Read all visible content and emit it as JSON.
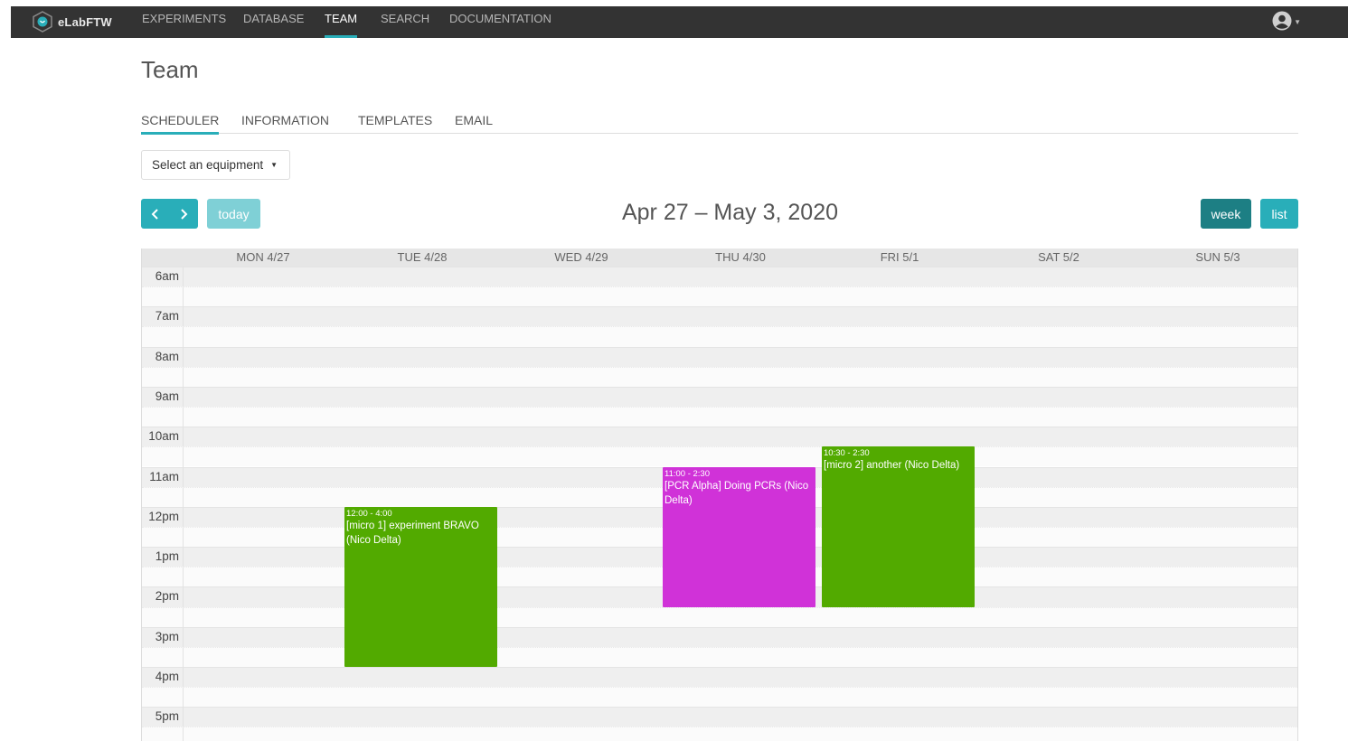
{
  "nav": {
    "brand": "eLabFTW",
    "items": [
      {
        "label": "EXPERIMENTS"
      },
      {
        "label": "DATABASE"
      },
      {
        "label": "TEAM"
      },
      {
        "label": "SEARCH"
      },
      {
        "label": "DOCUMENTATION"
      }
    ],
    "active": "TEAM",
    "user_icon": "user-circle-icon"
  },
  "page": {
    "title": "Team"
  },
  "tabs": [
    {
      "label": "SCHEDULER"
    },
    {
      "label": "INFORMATION"
    },
    {
      "label": "TEMPLATES"
    },
    {
      "label": "EMAIL"
    }
  ],
  "active_tab": "SCHEDULER",
  "equipment_select": {
    "label": "Select an equipment"
  },
  "calendar": {
    "range_title": "Apr 27 – May 3, 2020",
    "today_label": "today",
    "week_label": "week",
    "list_label": "list",
    "prev_icon": "chevron-left-icon",
    "next_icon": "chevron-right-icon",
    "days": [
      "MON 4/27",
      "TUE 4/28",
      "WED 4/29",
      "THU 4/30",
      "FRI 5/1",
      "SAT 5/2",
      "SUN 5/3"
    ],
    "hours": [
      "6am",
      "7am",
      "8am",
      "9am",
      "10am",
      "11am",
      "12pm",
      "1pm",
      "2pm",
      "3pm",
      "4pm",
      "5pm"
    ],
    "events": [
      {
        "day": "TUE 4/28",
        "start": "12:00",
        "end": "16:00",
        "time": "12:00 - 4:00",
        "title": "[micro 1] experiment BRAVO (Nico Delta)",
        "color": "#52aa00"
      },
      {
        "day": "THU 4/30",
        "start": "11:00",
        "end": "14:30",
        "time": "11:00 - 2:30",
        "title": "[PCR Alpha] Doing PCRs (Nico Delta)",
        "color": "#d032d8"
      },
      {
        "day": "FRI 5/1",
        "start": "10:30",
        "end": "14:30",
        "time": "10:30 - 2:30",
        "title": "[micro 2] another (Nico Delta)",
        "color": "#52aa00"
      }
    ]
  },
  "colors": {
    "navbar": "#333333",
    "accent": "#29aeb9",
    "active_button": "#1d7f84"
  }
}
